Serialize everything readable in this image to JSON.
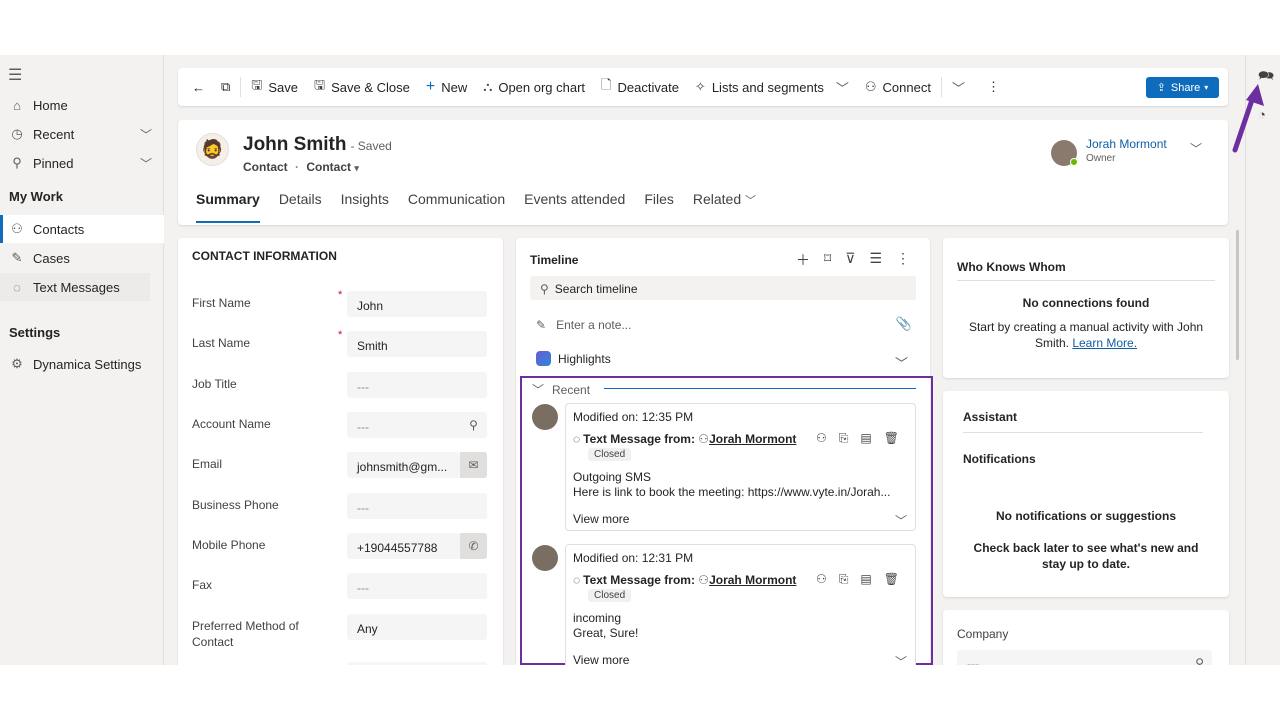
{
  "sidebar": {
    "items": [
      {
        "label": "Home",
        "icon": "home-icon"
      },
      {
        "label": "Recent",
        "icon": "clock-icon"
      },
      {
        "label": "Pinned",
        "icon": "pin-icon"
      }
    ],
    "mywork_title": "My Work",
    "mywork_items": [
      {
        "label": "Contacts",
        "icon": "person-icon"
      },
      {
        "label": "Cases",
        "icon": "wrench-icon"
      },
      {
        "label": "Text Messages",
        "icon": "chat-icon"
      }
    ],
    "settings_title": "Settings",
    "settings_items": [
      {
        "label": "Dynamica Settings",
        "icon": "gears-icon"
      }
    ]
  },
  "toolbar": {
    "save": "Save",
    "save_close": "Save & Close",
    "new": "New",
    "org_chart": "Open org chart",
    "deactivate": "Deactivate",
    "lists": "Lists and segments",
    "connect": "Connect",
    "share": "Share"
  },
  "header": {
    "name": "John Smith",
    "saved": "- Saved",
    "entity": "Contact",
    "form": "Contact",
    "owner_name": "Jorah Mormont",
    "owner_role": "Owner",
    "tabs": [
      "Summary",
      "Details",
      "Insights",
      "Communication",
      "Events attended",
      "Files",
      "Related"
    ]
  },
  "contact_info": {
    "title": "CONTACT INFORMATION",
    "fields": [
      {
        "label": "First Name",
        "value": "John",
        "required": "*"
      },
      {
        "label": "Last Name",
        "value": "Smith",
        "required": "*"
      },
      {
        "label": "Job Title",
        "value": "---"
      },
      {
        "label": "Account Name",
        "value": "---"
      },
      {
        "label": "Email",
        "value": "johnsmith@gm..."
      },
      {
        "label": "Business Phone",
        "value": "---"
      },
      {
        "label": "Mobile Phone",
        "value": "+19044557788"
      },
      {
        "label": "Fax",
        "value": "---"
      },
      {
        "label": "Preferred Method of Contact",
        "value": "Any"
      }
    ]
  },
  "timeline": {
    "title": "Timeline",
    "search_placeholder": "Search timeline",
    "note_placeholder": "Enter a note...",
    "highlights": "Highlights",
    "recent": "Recent",
    "activities": [
      {
        "modified": "Modified on: 12:35 PM",
        "title_prefix": "Text Message from:",
        "from": "Jorah Mormont",
        "status": "Closed",
        "line1": "Outgoing SMS",
        "line2": "Here is link to book the meeting: https://www.vyte.in/Jorah...",
        "view_more": "View more"
      },
      {
        "modified": "Modified on: 12:31 PM",
        "title_prefix": "Text Message from:",
        "from": "Jorah Mormont",
        "status": "Closed",
        "line1": "incoming",
        "line2": "Great, Sure!",
        "view_more": "View more"
      }
    ]
  },
  "who_knows": {
    "title": "Who Knows Whom",
    "empty_title": "No connections found",
    "empty_text": "Start by creating a manual activity with John Smith.",
    "learn_more": "Learn More."
  },
  "assistant": {
    "title": "Assistant",
    "notifications": "Notifications",
    "empty_title": "No notifications or suggestions",
    "empty_text": "Check back later to see what's new and stay up to date."
  },
  "company": {
    "label": "Company",
    "value": "---"
  },
  "colors": {
    "accent": "#0f6cbd",
    "highlight_border": "#6b2fa0",
    "arrow": "#6b2fa0"
  }
}
